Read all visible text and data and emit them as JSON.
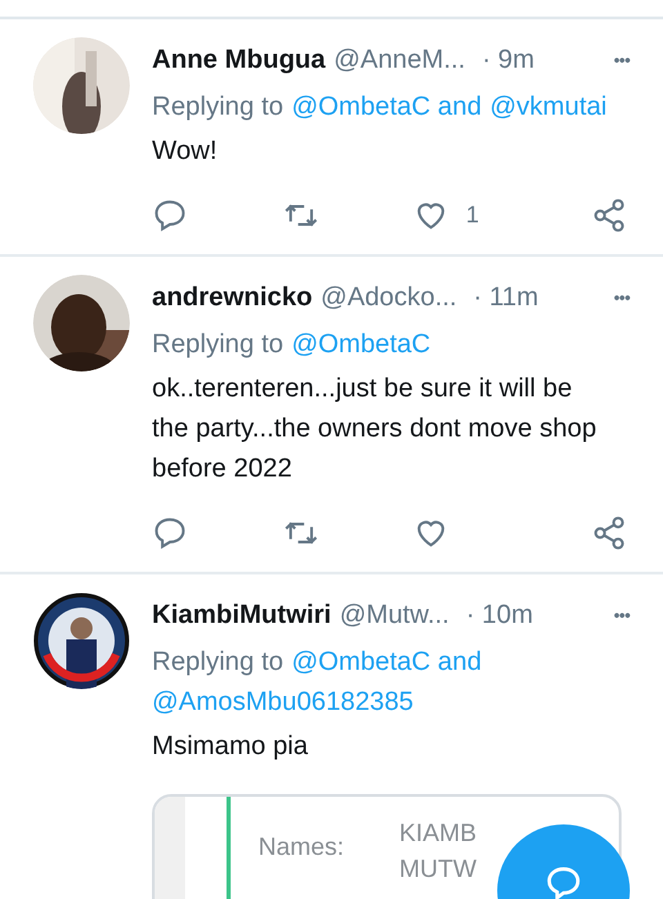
{
  "tweets": [
    {
      "name": "Anne Mbugua",
      "handle": "@AnneM...",
      "time": "· 9m",
      "more": "•••",
      "replying": {
        "label": "Replying to",
        "mentions": [
          "@OmbetaC and",
          "@vkmutai"
        ]
      },
      "text": "Wow!",
      "likes": "1"
    },
    {
      "name": "andrewnicko",
      "handle": "@Adocko...",
      "time": "· 11m",
      "more": "•••",
      "replying": {
        "label": "Replying to",
        "mentions": [
          "@OmbetaC"
        ]
      },
      "text": "ok..terenteren...just be sure it will be the party...the owners dont move shop before 2022"
    },
    {
      "name": "KiambiMutwiri",
      "handle": "@Mutw...",
      "time": "· 10m",
      "more": "•••",
      "replying": {
        "label": "Replying to",
        "mentions": [
          "@OmbetaC and",
          "@AmosMbu06182385"
        ]
      },
      "text": "Msimamo pia",
      "attachment": {
        "label": "Names:",
        "value_lines": [
          "KIAMB",
          "MUTW"
        ]
      }
    }
  ]
}
